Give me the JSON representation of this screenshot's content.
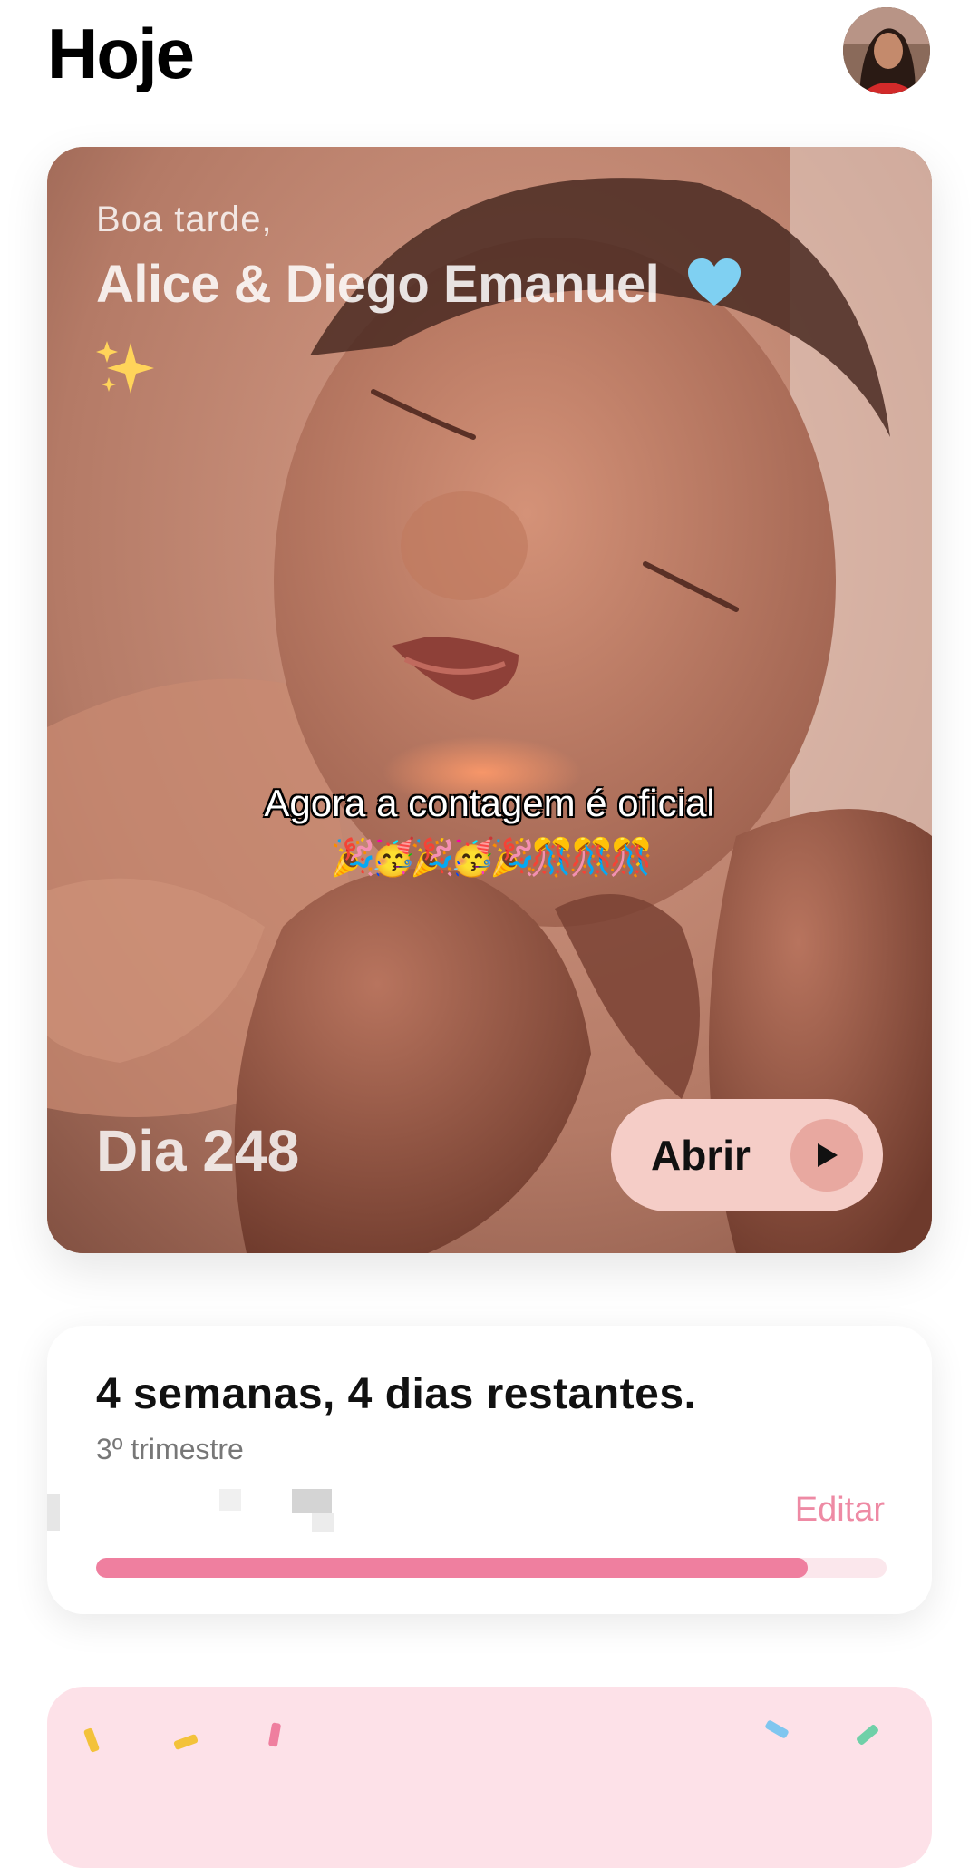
{
  "header": {
    "title": "Hoje"
  },
  "hero": {
    "greeting": "Boa tarde,",
    "names": "Alice  & Diego Emanuel",
    "heart_emoji": "blue-heart",
    "sparkles_emoji": "sparkles",
    "caption": "Agora a contagem é oficial",
    "caption_emojis": "🎉🥳🎉🥳🎉🎊🎊🎊",
    "day_label": "Dia 248",
    "open_button_label": "Abrir"
  },
  "pregnancy_card": {
    "remaining": "4 semanas, 4 dias restantes.",
    "trimester": "3º trimestre",
    "edit_label": "Editar",
    "progress": 0.9
  },
  "colors": {
    "accent_pink": "#ef7f9f",
    "progress_track": "#fbe7ec",
    "edit_text": "#ee8aa4",
    "open_button_bg": "#f5cdc7"
  }
}
